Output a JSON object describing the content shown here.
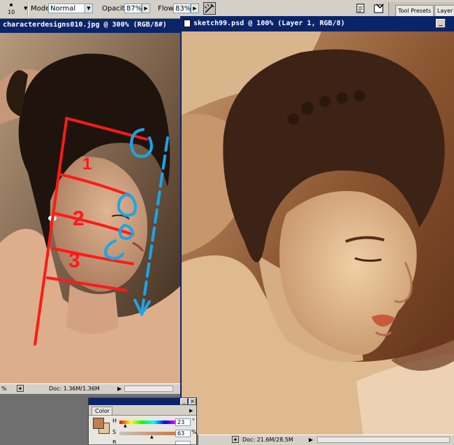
{
  "options_bar": {
    "brush_size": "10",
    "mode_label": "Mode:",
    "mode_value": "Normal",
    "opacity_label": "Opacity:",
    "opacity_value": "87%",
    "flow_label": "Flow:",
    "flow_value": "83%",
    "tabs": [
      "Tool Presets",
      "Layer C"
    ]
  },
  "left_doc": {
    "title": "characterdesigns010.jpg @ 300% (RGB/8#)",
    "zoom": "%",
    "doc_info": "Doc: 1.36M/1.36M",
    "annotations": [
      "1",
      "2",
      "3"
    ]
  },
  "right_doc": {
    "title": "sketch99.psd @ 100% (Layer 1, RGB/8)",
    "doc_info": "Doc: 21.6M/28.5M"
  },
  "color_palette": {
    "tab_label": "Color",
    "h_label": "H",
    "h_value": "23",
    "h_unit": "°",
    "s_label": "S",
    "s_value": "63",
    "s_unit": "%",
    "b_label": "B",
    "close_symbol": "×",
    "foreground": "#c17c4f",
    "background": "#e9c89e"
  },
  "colors": {
    "titlebar": "#0a246a",
    "annotation_red": "#ff1a1a",
    "annotation_blue": "#1aa6e8"
  }
}
